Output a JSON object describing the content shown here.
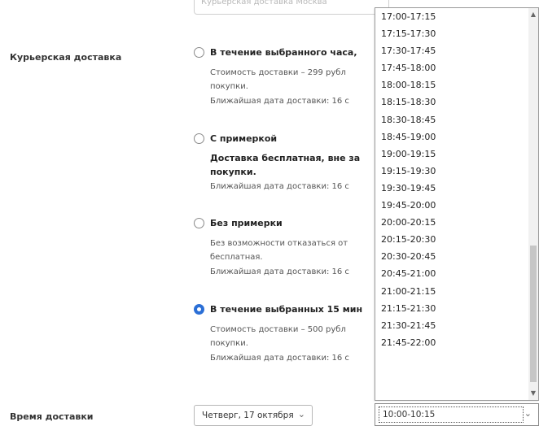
{
  "top_field": {
    "value": "Курьерская доставка Москва"
  },
  "courier": {
    "label": "Курьерская доставка",
    "options": [
      {
        "title": "В течение выбранного часа,",
        "lines": [
          "Стоимость доставки – 299 рубл",
          "покупки.",
          "Ближайшая дата доставки: 16 с"
        ],
        "checked": false
      },
      {
        "title": "С примеркой",
        "lines": [
          "Доставка бесплатная, вне за",
          "покупки.",
          "Ближайшая дата доставки: 16 с"
        ],
        "bold_lines": 2,
        "checked": false
      },
      {
        "title": "Без примерки",
        "lines": [
          "Без возможности отказаться от",
          "бесплатная.",
          "Ближайшая дата доставки: 16 с"
        ],
        "checked": false
      },
      {
        "title": "В течение выбранных 15 мин",
        "lines": [
          "Стоимость доставки – 500 рубл",
          "покупки.",
          "Ближайшая дата доставки: 16 с"
        ],
        "checked": true
      }
    ]
  },
  "delivery_time": {
    "label": "Время доставки",
    "date_value": "Четверг, 17 октября",
    "time_value": "10:00-10:15"
  },
  "time_slots": [
    "17:00-17:15",
    "17:15-17:30",
    "17:30-17:45",
    "17:45-18:00",
    "18:00-18:15",
    "18:15-18:30",
    "18:30-18:45",
    "18:45-19:00",
    "19:00-19:15",
    "19:15-19:30",
    "19:30-19:45",
    "19:45-20:00",
    "20:00-20:15",
    "20:15-20:30",
    "20:30-20:45",
    "20:45-21:00",
    "21:00-21:15",
    "21:15-21:30",
    "21:30-21:45",
    "21:45-22:00"
  ],
  "colors": {
    "accent": "#2b6fd6",
    "border": "#b7b7b7"
  },
  "icons": {
    "chevron": "chevron-down-icon",
    "scroll_up": "scroll-up-arrow-icon",
    "scroll_down": "scroll-down-arrow-icon"
  }
}
